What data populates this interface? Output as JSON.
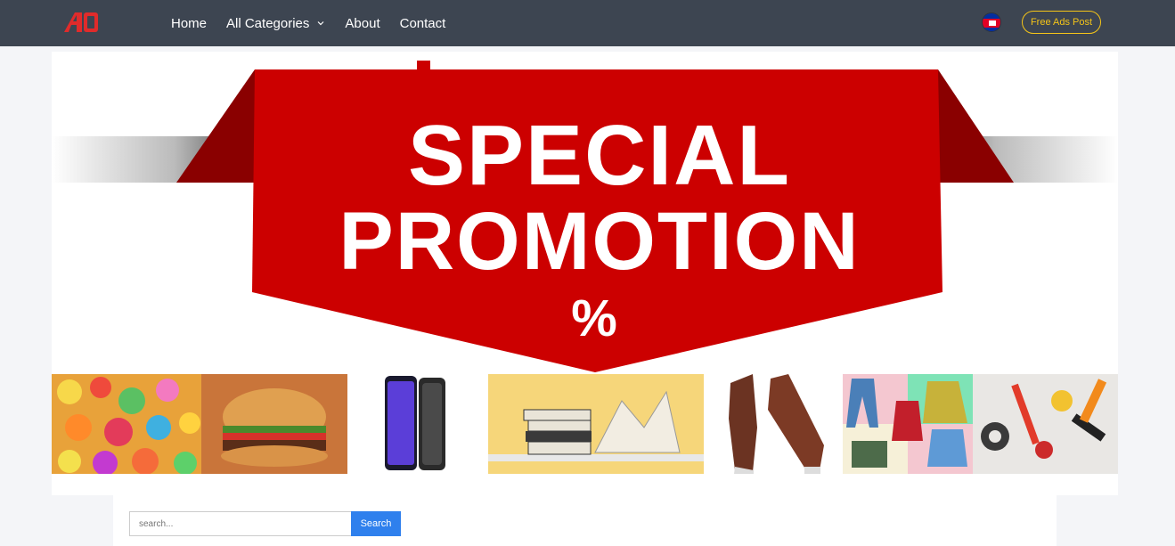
{
  "header": {
    "logo_text": "AD",
    "nav": [
      {
        "label": "Home"
      },
      {
        "label": "All Categories"
      },
      {
        "label": "About"
      },
      {
        "label": "Contact"
      }
    ],
    "language_flag": "cambodia-flag-icon",
    "post_button": "Free Ads Post"
  },
  "banner": {
    "line1": "SPECIAL",
    "line2": "PROMOTION",
    "symbol": "%",
    "product_images": [
      "candy",
      "burger",
      "smartphone",
      "books",
      "shoes",
      "clothes",
      "tools"
    ]
  },
  "search": {
    "placeholder": "search...",
    "button": "Search"
  },
  "colors": {
    "header_bg": "#3d4551",
    "accent_yellow": "#f5c518",
    "promo_red": "#cc0000",
    "search_blue": "#2f80ed"
  }
}
